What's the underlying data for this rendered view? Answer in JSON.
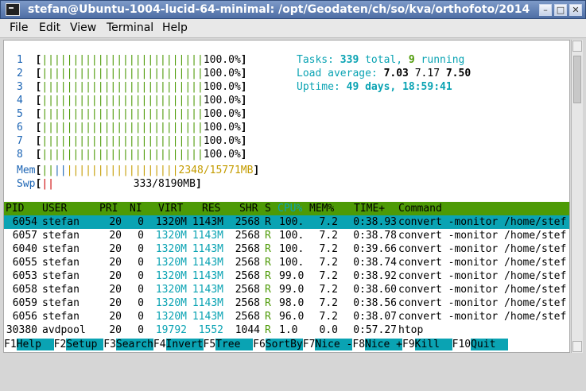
{
  "window": {
    "title": "stefan@Ubuntu-1004-lucid-64-minimal: /opt/Geodaten/ch/so/kva/orthofoto/2014",
    "buttons": [
      "–",
      "□",
      "✕"
    ]
  },
  "menu": [
    "File",
    "Edit",
    "View",
    "Terminal",
    "Help"
  ],
  "cpus": [
    {
      "label": "1",
      "bar": "||||||||||||||||||||||||||",
      "pct": "100.0%"
    },
    {
      "label": "2",
      "bar": "||||||||||||||||||||||||||",
      "pct": "100.0%"
    },
    {
      "label": "3",
      "bar": "||||||||||||||||||||||||||",
      "pct": "100.0%"
    },
    {
      "label": "4",
      "bar": "||||||||||||||||||||||||||",
      "pct": "100.0%"
    },
    {
      "label": "5",
      "bar": "||||||||||||||||||||||||||",
      "pct": "100.0%"
    },
    {
      "label": "6",
      "bar": "||||||||||||||||||||||||||",
      "pct": "100.0%"
    },
    {
      "label": "7",
      "bar": "||||||||||||||||||||||||||",
      "pct": "100.0%"
    },
    {
      "label": "8",
      "bar": "||||||||||||||||||||||||||",
      "pct": "100.0%"
    }
  ],
  "mem": {
    "label": "Mem",
    "bar1": "||",
    "bar2": "||",
    "bar3": "||||||||||||||||||",
    "value": "2348/15771MB"
  },
  "swp": {
    "label": "Swp",
    "bar": "||",
    "value": "333/8190MB"
  },
  "stats": {
    "tasks_label": "Tasks: ",
    "tasks_total": "339",
    "tasks_total_label": " total, ",
    "tasks_running": "9",
    "tasks_running_label": " running",
    "load_label": "Load average: ",
    "load1": "7.03",
    "load5": "7.17",
    "load15": "7.50",
    "uptime_label": "Uptime: ",
    "uptime_value": "49 days, 18:59:41"
  },
  "table": {
    "headers": {
      "pid": "PID",
      "user": "USER",
      "pri": "PRI",
      "ni": "NI",
      "virt": "VIRT",
      "res": "RES",
      "shr": "SHR",
      "s": "S",
      "cpu": "CPU%",
      "mem": "MEM%",
      "time": "TIME+",
      "cmd": "Command"
    },
    "rows": [
      {
        "pid": "6054",
        "user": "stefan",
        "pri": "20",
        "ni": "0",
        "virt": "1320M",
        "res": "1143M",
        "shr": "2568",
        "s": "R",
        "cpu": "100.",
        "mem": "7.2",
        "time": "0:38.93",
        "cmd": "convert -monitor /home/stef"
      },
      {
        "pid": "6057",
        "user": "stefan",
        "pri": "20",
        "ni": "0",
        "virt": "1320M",
        "res": "1143M",
        "shr": "2568",
        "s": "R",
        "cpu": "100.",
        "mem": "7.2",
        "time": "0:38.78",
        "cmd": "convert -monitor /home/stef"
      },
      {
        "pid": "6040",
        "user": "stefan",
        "pri": "20",
        "ni": "0",
        "virt": "1320M",
        "res": "1143M",
        "shr": "2568",
        "s": "R",
        "cpu": "100.",
        "mem": "7.2",
        "time": "0:39.66",
        "cmd": "convert -monitor /home/stef"
      },
      {
        "pid": "6055",
        "user": "stefan",
        "pri": "20",
        "ni": "0",
        "virt": "1320M",
        "res": "1143M",
        "shr": "2568",
        "s": "R",
        "cpu": "100.",
        "mem": "7.2",
        "time": "0:38.74",
        "cmd": "convert -monitor /home/stef"
      },
      {
        "pid": "6053",
        "user": "stefan",
        "pri": "20",
        "ni": "0",
        "virt": "1320M",
        "res": "1143M",
        "shr": "2568",
        "s": "R",
        "cpu": "99.0",
        "mem": "7.2",
        "time": "0:38.92",
        "cmd": "convert -monitor /home/stef"
      },
      {
        "pid": "6058",
        "user": "stefan",
        "pri": "20",
        "ni": "0",
        "virt": "1320M",
        "res": "1143M",
        "shr": "2568",
        "s": "R",
        "cpu": "99.0",
        "mem": "7.2",
        "time": "0:38.60",
        "cmd": "convert -monitor /home/stef"
      },
      {
        "pid": "6059",
        "user": "stefan",
        "pri": "20",
        "ni": "0",
        "virt": "1320M",
        "res": "1143M",
        "shr": "2568",
        "s": "R",
        "cpu": "98.0",
        "mem": "7.2",
        "time": "0:38.56",
        "cmd": "convert -monitor /home/stef"
      },
      {
        "pid": "6056",
        "user": "stefan",
        "pri": "20",
        "ni": "0",
        "virt": "1320M",
        "res": "1143M",
        "shr": "2568",
        "s": "R",
        "cpu": "96.0",
        "mem": "7.2",
        "time": "0:38.07",
        "cmd": "convert -monitor /home/stef"
      },
      {
        "pid": "30380",
        "user": "avdpool",
        "pri": "20",
        "ni": "0",
        "virt": "19792",
        "res": "1552",
        "shr": "1044",
        "s": "R",
        "cpu": "1.0",
        "mem": "0.0",
        "time": "0:57.27",
        "cmd": "htop"
      }
    ]
  },
  "footer": [
    {
      "key": "F1",
      "label": "Help  "
    },
    {
      "key": "F2",
      "label": "Setup "
    },
    {
      "key": "F3",
      "label": "Search"
    },
    {
      "key": "F4",
      "label": "Invert"
    },
    {
      "key": "F5",
      "label": "Tree  "
    },
    {
      "key": "F6",
      "label": "SortBy"
    },
    {
      "key": "F7",
      "label": "Nice -"
    },
    {
      "key": "F8",
      "label": "Nice +"
    },
    {
      "key": "F9",
      "label": "Kill  "
    },
    {
      "key": "F10",
      "label": "Quit  "
    }
  ],
  "colors": {
    "accent": "#0aa3b3",
    "header": "#4d9a06",
    "title": "#5b79b0"
  }
}
